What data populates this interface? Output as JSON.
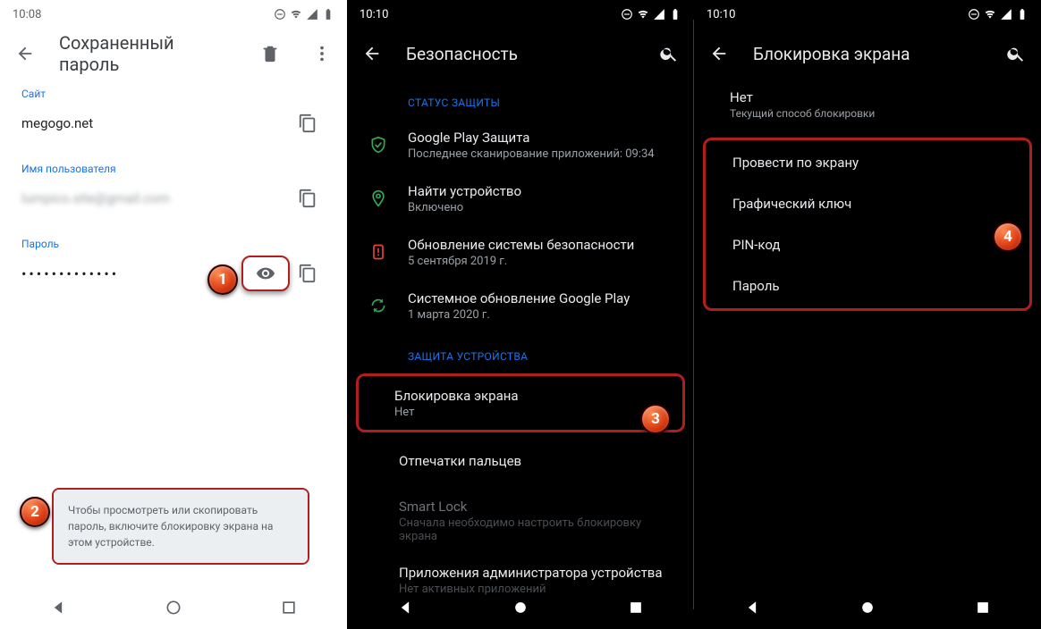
{
  "panel1": {
    "time": "10:08",
    "appbar_title": "Сохраненный пароль",
    "site_label": "Сайт",
    "site_value": "megogo.net",
    "user_label": "Имя пользователя",
    "user_value": "lumpico.site@gmail.com",
    "password_label": "Пароль",
    "password_dots": "•••••••••••••",
    "toast": "Чтобы просмотреть или скопировать пароль, включите блокировку экрана на этом устройстве."
  },
  "panel2": {
    "time": "10:10",
    "appbar_title": "Безопасность",
    "section_status": "СТАТУС ЗАЩИТЫ",
    "rows_status": [
      {
        "title": "Google Play Защита",
        "sub": "Последнее сканирование приложений: 09:34",
        "icon": "shield-check",
        "color": "#34a853"
      },
      {
        "title": "Найти устройство",
        "sub": "Включено",
        "icon": "pin",
        "color": "#34a853"
      },
      {
        "title": "Обновление системы безопасности",
        "sub": "5 сентября 2019 г.",
        "icon": "alert",
        "color": "#ea4335"
      },
      {
        "title": "Системное обновление Google Play",
        "sub": "1 марта 2020 г.",
        "icon": "refresh",
        "color": "#34a853"
      }
    ],
    "section_device": "ЗАЩИТА УСТРОЙСТВА",
    "row_lock": {
      "title": "Блокировка экрана",
      "sub": "Нет"
    },
    "row_fingerprint": {
      "title": "Отпечатки пальцев"
    },
    "row_smart": {
      "title": "Smart Lock",
      "sub": "Сначала необходимо настроить блокировку экрана"
    },
    "row_admin": {
      "title": "Приложения администратора устройства",
      "sub": "Нет активных приложений"
    }
  },
  "panel3": {
    "time": "10:10",
    "appbar_title": "Блокировка экрана",
    "current": {
      "title": "Нет",
      "sub": "Текущий способ блокировки"
    },
    "options": [
      "Провести по экрану",
      "Графический ключ",
      "PIN-код",
      "Пароль"
    ]
  },
  "callouts": {
    "1": "1",
    "2": "2",
    "3": "3",
    "4": "4"
  }
}
